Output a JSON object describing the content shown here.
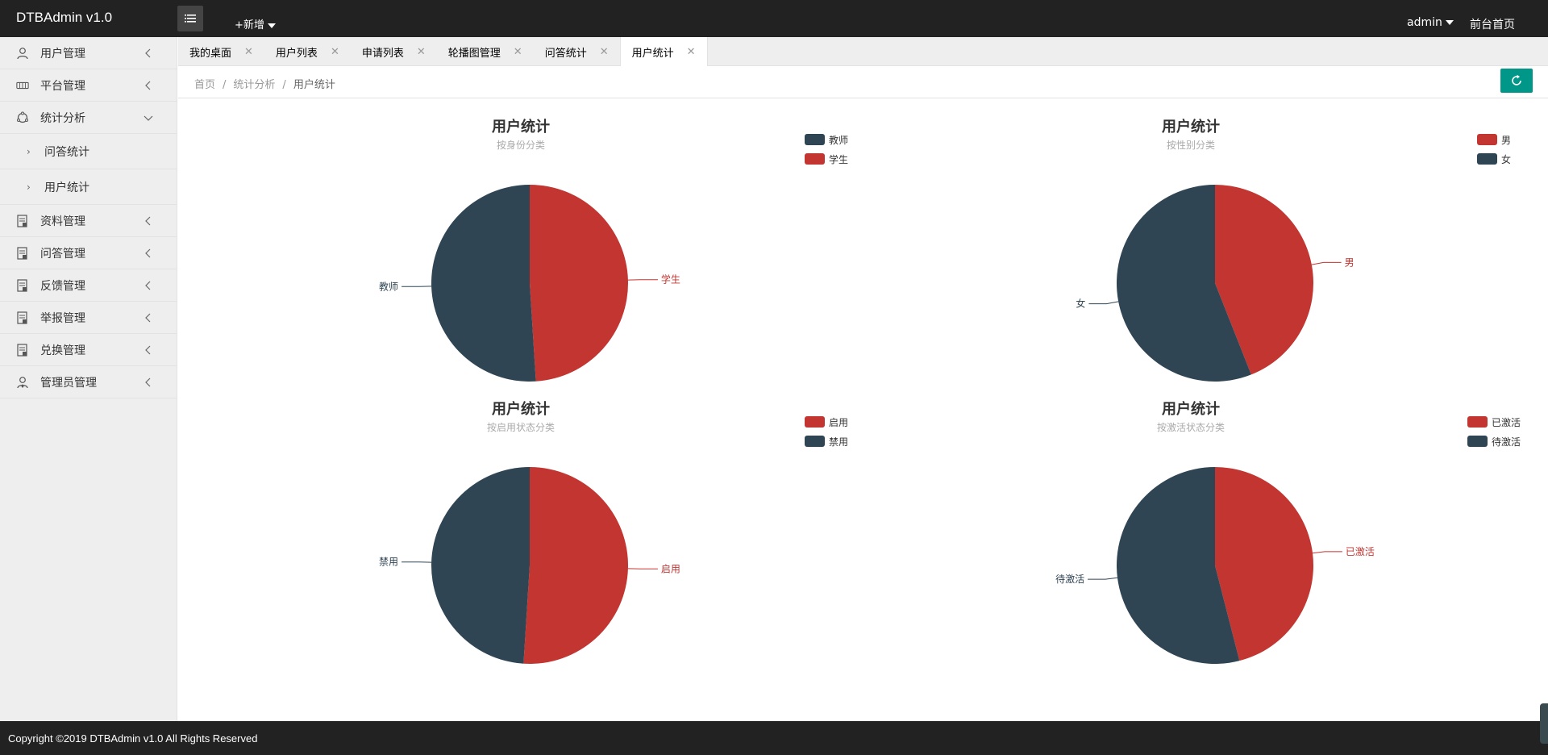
{
  "header": {
    "logo": "DTBAdmin v1.0",
    "add_label": "+新增",
    "user": "admin",
    "front_link": "前台首页"
  },
  "sidebar": {
    "items": [
      {
        "label": "用户管理",
        "icon": "user-icon"
      },
      {
        "label": "平台管理",
        "icon": "platform-icon"
      },
      {
        "label": "统计分析",
        "icon": "stats-icon",
        "expanded": true,
        "children": [
          "问答统计",
          "用户统计"
        ]
      },
      {
        "label": "资料管理",
        "icon": "doc-icon"
      },
      {
        "label": "问答管理",
        "icon": "doc-icon"
      },
      {
        "label": "反馈管理",
        "icon": "doc-icon"
      },
      {
        "label": "举报管理",
        "icon": "doc-icon"
      },
      {
        "label": "兑换管理",
        "icon": "doc-icon"
      },
      {
        "label": "管理员管理",
        "icon": "admin-icon"
      }
    ]
  },
  "tabs": [
    {
      "label": "我的桌面"
    },
    {
      "label": "用户列表"
    },
    {
      "label": "申请列表"
    },
    {
      "label": "轮播图管理"
    },
    {
      "label": "问答统计"
    },
    {
      "label": "用户统计",
      "active": true
    }
  ],
  "breadcrumb": {
    "home": "首页",
    "section": "统计分析",
    "current": "用户统计"
  },
  "colors": {
    "red": "#c23531",
    "navy": "#2f4554",
    "accent": "#009688"
  },
  "chart_data": [
    {
      "type": "pie",
      "title": "用户统计",
      "subtitle": "按身份分类",
      "legend": [
        "教师",
        "学生"
      ],
      "slices": [
        {
          "name": "学生",
          "value": 49,
          "color": "#c23531"
        },
        {
          "name": "教师",
          "value": 51,
          "color": "#2f4554"
        }
      ]
    },
    {
      "type": "pie",
      "title": "用户统计",
      "subtitle": "按性别分类",
      "legend": [
        "男",
        "女"
      ],
      "slices": [
        {
          "name": "男",
          "value": 44,
          "color": "#c23531"
        },
        {
          "name": "女",
          "value": 56,
          "color": "#2f4554"
        }
      ]
    },
    {
      "type": "pie",
      "title": "用户统计",
      "subtitle": "按启用状态分类",
      "legend": [
        "启用",
        "禁用"
      ],
      "slices": [
        {
          "name": "启用",
          "value": 51,
          "color": "#c23531"
        },
        {
          "name": "禁用",
          "value": 49,
          "color": "#2f4554"
        }
      ]
    },
    {
      "type": "pie",
      "title": "用户统计",
      "subtitle": "按激活状态分类",
      "legend": [
        "已激活",
        "待激活"
      ],
      "slices": [
        {
          "name": "已激活",
          "value": 46,
          "color": "#c23531"
        },
        {
          "name": "待激活",
          "value": 54,
          "color": "#2f4554"
        }
      ]
    }
  ],
  "footer": {
    "copyright": "Copyright ©2019 DTBAdmin v1.0 All Rights Reserved"
  }
}
